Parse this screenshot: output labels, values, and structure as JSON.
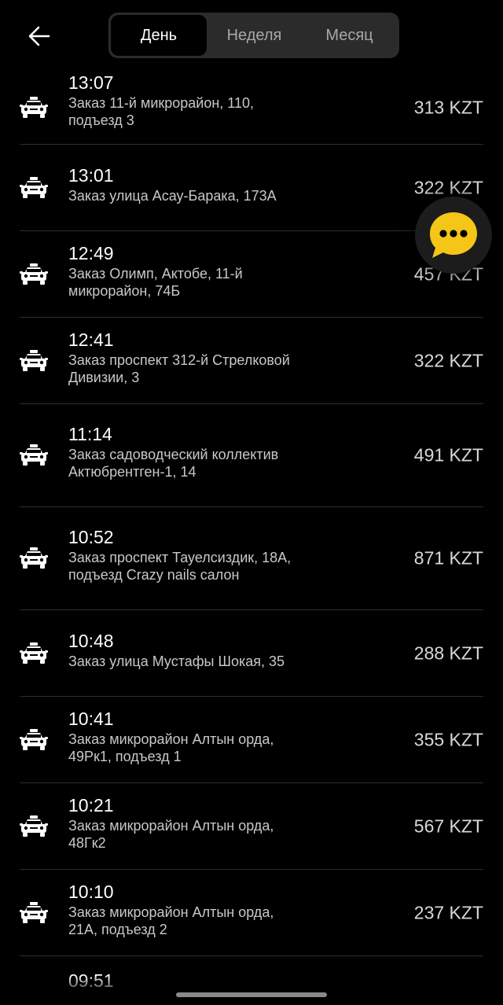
{
  "header": {
    "back_icon": "arrow-left-icon",
    "tabs": [
      {
        "label": "День",
        "active": true
      },
      {
        "label": "Неделя",
        "active": false
      },
      {
        "label": "Месяц",
        "active": false
      }
    ]
  },
  "orders": [
    {
      "time": "13:07",
      "address": "Заказ 11-й микрорайон, 110, подъезд 3",
      "price": "313 KZT"
    },
    {
      "time": "13:01",
      "address": "Заказ улица Асау-Барака, 173А",
      "price": "322 KZT"
    },
    {
      "time": "12:49",
      "address": "Заказ Олимп, Актобе, 11-й микрорайон, 74Б",
      "price": "457 KZT"
    },
    {
      "time": "12:41",
      "address": "Заказ проспект 312-й Стрелковой Дивизии, 3",
      "price": "322 KZT"
    },
    {
      "time": "11:14",
      "address": "Заказ садоводческий коллектив Актюбрентген-1, 14",
      "price": "491 KZT"
    },
    {
      "time": "10:52",
      "address": "Заказ проспект Тауелсиздик, 18А, подъезд Crazy nails салон",
      "price": "871 KZT"
    },
    {
      "time": "10:48",
      "address": "Заказ улица Мустафы Шокая, 35",
      "price": "288 KZT"
    },
    {
      "time": "10:41",
      "address": "Заказ микрорайон Алтын орда, 49Рк1, подъезд 1",
      "price": "355 KZT"
    },
    {
      "time": "10:21",
      "address": "Заказ микрорайон Алтын орда, 48Гк2",
      "price": "567 KZT"
    },
    {
      "time": "10:10",
      "address": "Заказ микрорайон Алтын орда, 21А, подъезд 2",
      "price": "237 KZT"
    },
    {
      "time": "09:51",
      "address": "",
      "price": ""
    }
  ],
  "icons": {
    "row_icon": "taxi-car-icon",
    "chat_icon": "chat-bubble-icon"
  },
  "colors": {
    "background": "#000000",
    "accent": "#f5c518",
    "divider": "#2e2e2e"
  }
}
